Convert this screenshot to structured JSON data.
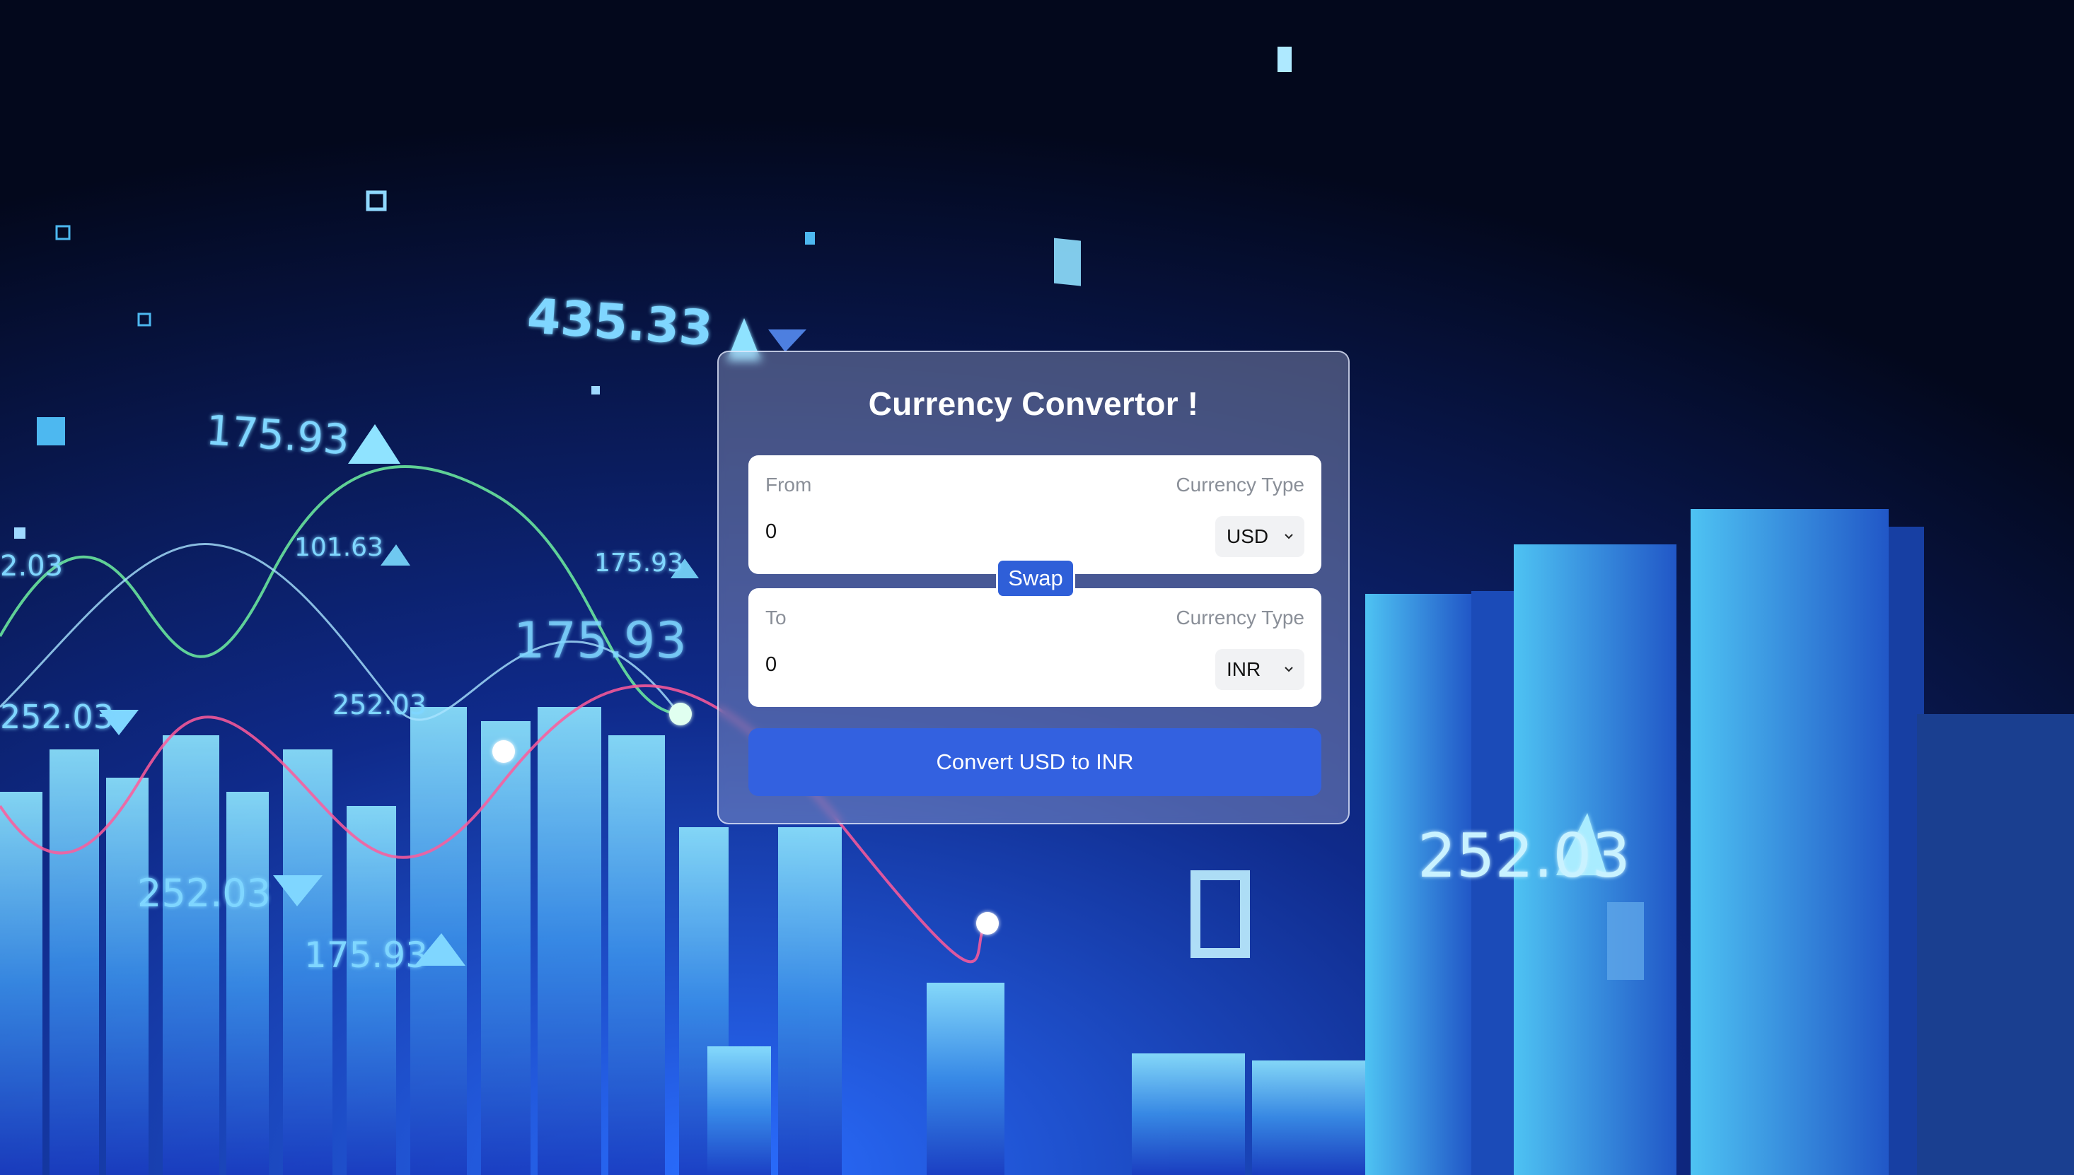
{
  "background": {
    "description_icon": "stock-market-chart-background",
    "numbers": [
      "435.33",
      "252.03",
      "175.93",
      "101.63",
      "175.93",
      "175.93",
      "252.03",
      "252.03",
      "252.03",
      "175.93",
      "252.03",
      "2.03"
    ]
  },
  "converter": {
    "title": "Currency Convertor !",
    "from": {
      "label": "From",
      "currency_label": "Currency Type",
      "amount": "0",
      "currency": "USD"
    },
    "swap_label": "Swap",
    "to": {
      "label": "To",
      "currency_label": "Currency Type",
      "amount": "0",
      "currency": "INR"
    },
    "convert_label": "Convert USD to INR"
  },
  "colors": {
    "button_blue": "#3361e0",
    "swap_blue": "#2f5fd8",
    "card_bg": "rgba(170,178,212,0.38)"
  }
}
